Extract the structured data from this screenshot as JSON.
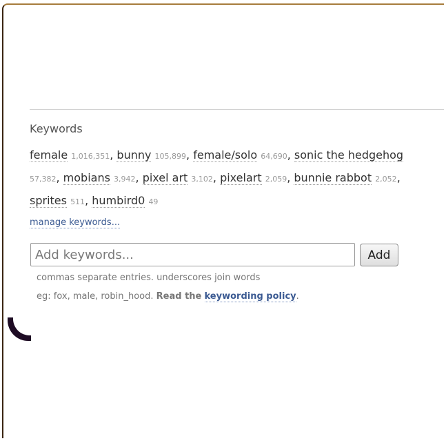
{
  "section": {
    "title": "Keywords"
  },
  "keywords": [
    {
      "name": "female",
      "count": "1,016,351"
    },
    {
      "name": "bunny",
      "count": "105,899"
    },
    {
      "name": "female/solo",
      "count": "64,690"
    },
    {
      "name": "sonic the hedgehog",
      "count": "57,382"
    },
    {
      "name": "mobians",
      "count": "3,942"
    },
    {
      "name": "pixel art",
      "count": "3,102"
    },
    {
      "name": "pixelart",
      "count": "2,059"
    },
    {
      "name": "bunnie rabbot",
      "count": "2,052"
    },
    {
      "name": "sprites",
      "count": "511"
    },
    {
      "name": "humbird0",
      "count": "49"
    }
  ],
  "manage_link": "manage keywords...",
  "input": {
    "placeholder": "Add keywords..."
  },
  "add_button": "Add",
  "hint": {
    "line1": "commas separate entries. underscores join words",
    "line2_prefix": "eg: fox, male, robin_hood.",
    "line2_bold": "Read the",
    "policy_link": "keywording policy",
    "line2_suffix": "."
  },
  "colors": {
    "link": "#3b5a92",
    "frame": "#a67c3c"
  }
}
